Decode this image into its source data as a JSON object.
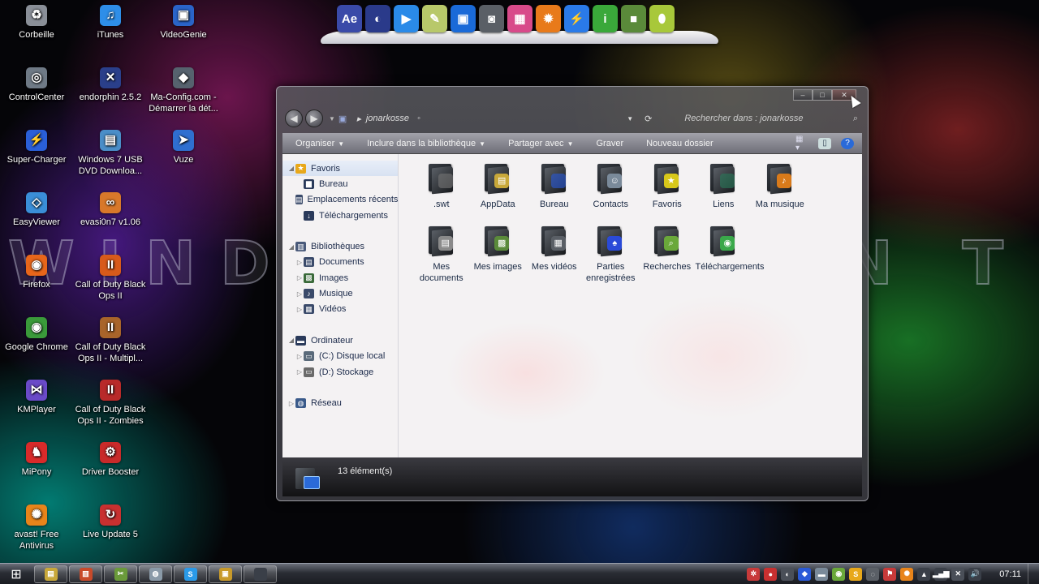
{
  "watermark": "WINDOWS SEVEN TITAN",
  "desktop_icons": [
    {
      "label": "Corbeille",
      "icon": "recycle-bin-icon",
      "glyph": "♻",
      "color": "#8a8f98"
    },
    {
      "label": "iTunes",
      "icon": "itunes-icon",
      "glyph": "♫",
      "color": "#2e8ee8"
    },
    {
      "label": "VideoGenie",
      "icon": "monitor-icon",
      "glyph": "▣",
      "color": "#2a64c8"
    },
    {
      "label": "ControlCenter",
      "icon": "control-center-icon",
      "glyph": "◎",
      "color": "#6f7a86"
    },
    {
      "label": "endorphin 2.5.2",
      "icon": "endorphin-icon",
      "glyph": "✕",
      "color": "#2a3f8a"
    },
    {
      "label": "Ma-Config.com - Démarrer la dét...",
      "icon": "ma-config-icon",
      "glyph": "◆",
      "color": "#56626e"
    },
    {
      "label": "Super-Charger",
      "icon": "super-charger-icon",
      "glyph": "⚡",
      "color": "#2a5fd8"
    },
    {
      "label": "Windows 7 USB DVD Downloa...",
      "icon": "usb-dvd-tool-icon",
      "glyph": "▤",
      "color": "#4a8ec8"
    },
    {
      "label": "Vuze",
      "icon": "vuze-icon",
      "glyph": "➤",
      "color": "#2f6fd0"
    },
    {
      "label": "EasyViewer",
      "icon": "easyviewer-icon",
      "glyph": "◇",
      "color": "#3a8ed8"
    },
    {
      "label": "evasi0n7 v1.06",
      "icon": "evasi0n-icon",
      "glyph": "∞",
      "color": "#d8782a"
    },
    {
      "label": "Firefox",
      "icon": "firefox-icon",
      "glyph": "◉",
      "color": "#e8661a"
    },
    {
      "label": "Call of Duty Black Ops II",
      "icon": "cod-black-ops-icon",
      "glyph": "II",
      "color": "#d85a1a"
    },
    {
      "label": "Google Chrome",
      "icon": "chrome-icon",
      "glyph": "◉",
      "color": "#3a9a3a"
    },
    {
      "label": "Call of Duty Black Ops II - Multipl...",
      "icon": "cod-multiplayer-icon",
      "glyph": "II",
      "color": "#a8642a"
    },
    {
      "label": "KMPlayer",
      "icon": "kmplayer-icon",
      "glyph": "⋈",
      "color": "#6a4ac8"
    },
    {
      "label": "Call of Duty Black Ops II - Zombies",
      "icon": "cod-zombies-icon",
      "glyph": "II",
      "color": "#b82a2a"
    },
    {
      "label": "MiPony",
      "icon": "mipony-icon",
      "glyph": "♞",
      "color": "#d82a2a"
    },
    {
      "label": "Driver Booster",
      "icon": "driver-booster-icon",
      "glyph": "⚙",
      "color": "#c82a2a"
    },
    {
      "label": "avast! Free Antivirus",
      "icon": "avast-icon",
      "glyph": "✺",
      "color": "#e8841a"
    },
    {
      "label": "Live Update 5",
      "icon": "live-update-icon",
      "glyph": "↻",
      "color": "#c83030"
    }
  ],
  "dock": [
    {
      "icon": "after-effects-icon",
      "glyph": "Ae",
      "color": "#3a4aa8"
    },
    {
      "icon": "cinema4d-icon",
      "glyph": "◐",
      "color": "#2a3a8a"
    },
    {
      "icon": "media-player-icon",
      "glyph": "▶",
      "color": "#2a8ae8"
    },
    {
      "icon": "notes-icon",
      "glyph": "✎",
      "color": "#b8c86a"
    },
    {
      "icon": "computer-icon",
      "glyph": "▣",
      "color": "#1a6ad8"
    },
    {
      "icon": "camera-icon",
      "glyph": "◙",
      "color": "#5a5f66"
    },
    {
      "icon": "color-palette-icon",
      "glyph": "▦",
      "color": "#d84a8a"
    },
    {
      "icon": "fire-game-icon",
      "glyph": "✹",
      "color": "#e87a1a"
    },
    {
      "icon": "lightning-icon",
      "glyph": "⚡",
      "color": "#2a7ae8"
    },
    {
      "icon": "info-icon",
      "glyph": "i",
      "color": "#3aa83a"
    },
    {
      "icon": "minecraft-icon",
      "glyph": "■",
      "color": "#5a8a3a"
    },
    {
      "icon": "egg-icon",
      "glyph": "⬮",
      "color": "#a8c83a"
    }
  ],
  "window": {
    "address": "jonarkosse",
    "search_placeholder": "Rechercher dans : jonarkosse",
    "controls": {
      "minimize": "–",
      "maximize": "□",
      "close": "✕"
    },
    "toolbar": [
      {
        "label": "Organiser",
        "dropdown": true
      },
      {
        "label": "Inclure dans la bibliothèque",
        "dropdown": true
      },
      {
        "label": "Partager avec",
        "dropdown": true
      },
      {
        "label": "Graver",
        "dropdown": false
      },
      {
        "label": "Nouveau dossier",
        "dropdown": false
      }
    ],
    "nav": [
      {
        "label": "Favoris",
        "level": 0,
        "icon": "star-icon",
        "glyph": "★",
        "color": "#e8a81a",
        "twisty": "◢",
        "selected": true
      },
      {
        "label": "Bureau",
        "level": 1,
        "icon": "desktop-icon",
        "glyph": "▆",
        "color": "#2a3a5a"
      },
      {
        "label": "Emplacements récents",
        "level": 1,
        "icon": "recent-places-icon",
        "glyph": "▤",
        "color": "#3a4a6a"
      },
      {
        "label": "Téléchargements",
        "level": 1,
        "icon": "downloads-icon",
        "glyph": "↓",
        "color": "#2a3a5a"
      },
      {
        "label": "",
        "spacer": true
      },
      {
        "label": "Bibliothèques",
        "level": 0,
        "icon": "libraries-icon",
        "glyph": "▥",
        "color": "#4a5a7a",
        "twisty": "◢"
      },
      {
        "label": "Documents",
        "level": 1,
        "icon": "documents-icon",
        "glyph": "▤",
        "color": "#3a4a6a",
        "twisty": "▷"
      },
      {
        "label": "Images",
        "level": 1,
        "icon": "images-icon",
        "glyph": "▩",
        "color": "#3a6a3a",
        "twisty": "▷"
      },
      {
        "label": "Musique",
        "level": 1,
        "icon": "music-icon",
        "glyph": "♪",
        "color": "#3a4a6a",
        "twisty": "▷"
      },
      {
        "label": "Vidéos",
        "level": 1,
        "icon": "videos-icon",
        "glyph": "▦",
        "color": "#3a4a6a",
        "twisty": "▷"
      },
      {
        "label": "",
        "spacer": true
      },
      {
        "label": "Ordinateur",
        "level": 0,
        "icon": "computer-icon",
        "glyph": "▬",
        "color": "#2a3a5a",
        "twisty": "◢"
      },
      {
        "label": "(C:) Disque local",
        "level": 1,
        "icon": "drive-c-icon",
        "glyph": "▭",
        "color": "#5a6a7a",
        "twisty": "▷"
      },
      {
        "label": "(D:) Stockage",
        "level": 1,
        "icon": "drive-d-icon",
        "glyph": "▭",
        "color": "#6a6a6a",
        "twisty": "▷"
      },
      {
        "label": "",
        "spacer": true
      },
      {
        "label": "Réseau",
        "level": 0,
        "icon": "network-icon",
        "glyph": "◍",
        "color": "#3a5a8a",
        "twisty": "▷"
      }
    ],
    "files": [
      {
        "label": ".swt",
        "icon": "folder-swt-icon",
        "emb": "",
        "color": "#777"
      },
      {
        "label": "AppData",
        "icon": "folder-appdata-icon",
        "emb": "▤",
        "color": "#c8a83a"
      },
      {
        "label": "Bureau",
        "icon": "folder-bureau-icon",
        "emb": "",
        "color": "#2a5ad8"
      },
      {
        "label": "Contacts",
        "icon": "folder-contacts-icon",
        "emb": "☺",
        "color": "#7a8a9a"
      },
      {
        "label": "Favoris",
        "icon": "folder-favoris-icon",
        "emb": "★",
        "color": "#d8c81a"
      },
      {
        "label": "Liens",
        "icon": "folder-liens-icon",
        "emb": "",
        "color": "#2a7a5a"
      },
      {
        "label": "Ma musique",
        "icon": "folder-music-icon",
        "emb": "♪",
        "color": "#d87a1a"
      },
      {
        "label": "Mes documents",
        "icon": "folder-documents-icon",
        "emb": "▤",
        "color": "#8a8a8a"
      },
      {
        "label": "Mes images",
        "icon": "folder-images-icon",
        "emb": "▩",
        "color": "#5a8a3a"
      },
      {
        "label": "Mes vidéos",
        "icon": "folder-videos-icon",
        "emb": "▦",
        "color": "#5a5f66"
      },
      {
        "label": "Parties enregistrées",
        "icon": "folder-saved-games-icon",
        "emb": "♠",
        "color": "#2a4ad8"
      },
      {
        "label": "Recherches",
        "icon": "folder-searches-icon",
        "emb": "⌕",
        "color": "#6aa83a"
      },
      {
        "label": "Téléchargements",
        "icon": "folder-downloads-icon",
        "emb": "◉",
        "color": "#3aa84a"
      }
    ],
    "status": "13 élément(s)"
  },
  "taskbar": {
    "pinned": [
      {
        "icon": "explorer-icon",
        "glyph": "▤",
        "color": "#c8a83a"
      },
      {
        "icon": "chart-app-icon",
        "glyph": "▥",
        "color": "#c84a2a"
      },
      {
        "icon": "tools-icon",
        "glyph": "✂",
        "color": "#6a9a3a"
      },
      {
        "icon": "disk-icon",
        "glyph": "◍",
        "color": "#8a9aa8"
      },
      {
        "icon": "skype-icon",
        "glyph": "S",
        "color": "#2a9ae8"
      },
      {
        "icon": "folder-window-icon",
        "glyph": "▣",
        "color": "#c89a2a"
      },
      {
        "icon": "blank-window-icon",
        "glyph": "",
        "color": "#3a3f48"
      }
    ],
    "tray": [
      {
        "icon": "tray-network-share-icon",
        "glyph": "✲",
        "color": "#c83a3a"
      },
      {
        "icon": "tray-antivirus-icon",
        "glyph": "●",
        "color": "#c83030"
      },
      {
        "icon": "tray-usb-icon",
        "glyph": "◐",
        "color": "#4a4f58"
      },
      {
        "icon": "tray-shield-icon",
        "glyph": "◆",
        "color": "#2a5ad8"
      },
      {
        "icon": "tray-driver-icon",
        "glyph": "▬",
        "color": "#7a8a9a"
      },
      {
        "icon": "tray-chat-icon",
        "glyph": "◉",
        "color": "#6aa83a"
      },
      {
        "icon": "tray-skype-icon",
        "glyph": "S",
        "color": "#e8a81a"
      },
      {
        "icon": "tray-bubble-icon",
        "glyph": "◌",
        "color": "#5a5f66"
      },
      {
        "icon": "tray-flag-icon",
        "glyph": "⚑",
        "color": "#c83a3a"
      },
      {
        "icon": "tray-avast-icon",
        "glyph": "✺",
        "color": "#e8841a"
      },
      {
        "icon": "tray-chevron-icon",
        "glyph": "▲",
        "color": "#3a3f48"
      },
      {
        "icon": "tray-signal-icon",
        "glyph": "▂▄▆",
        "color": "#3a3f48"
      },
      {
        "icon": "tray-tools-icon",
        "glyph": "✕",
        "color": "#4a4f58"
      },
      {
        "icon": "tray-volume-icon",
        "glyph": "🔊",
        "color": "#3a3f48"
      }
    ],
    "clock": "07:11"
  }
}
